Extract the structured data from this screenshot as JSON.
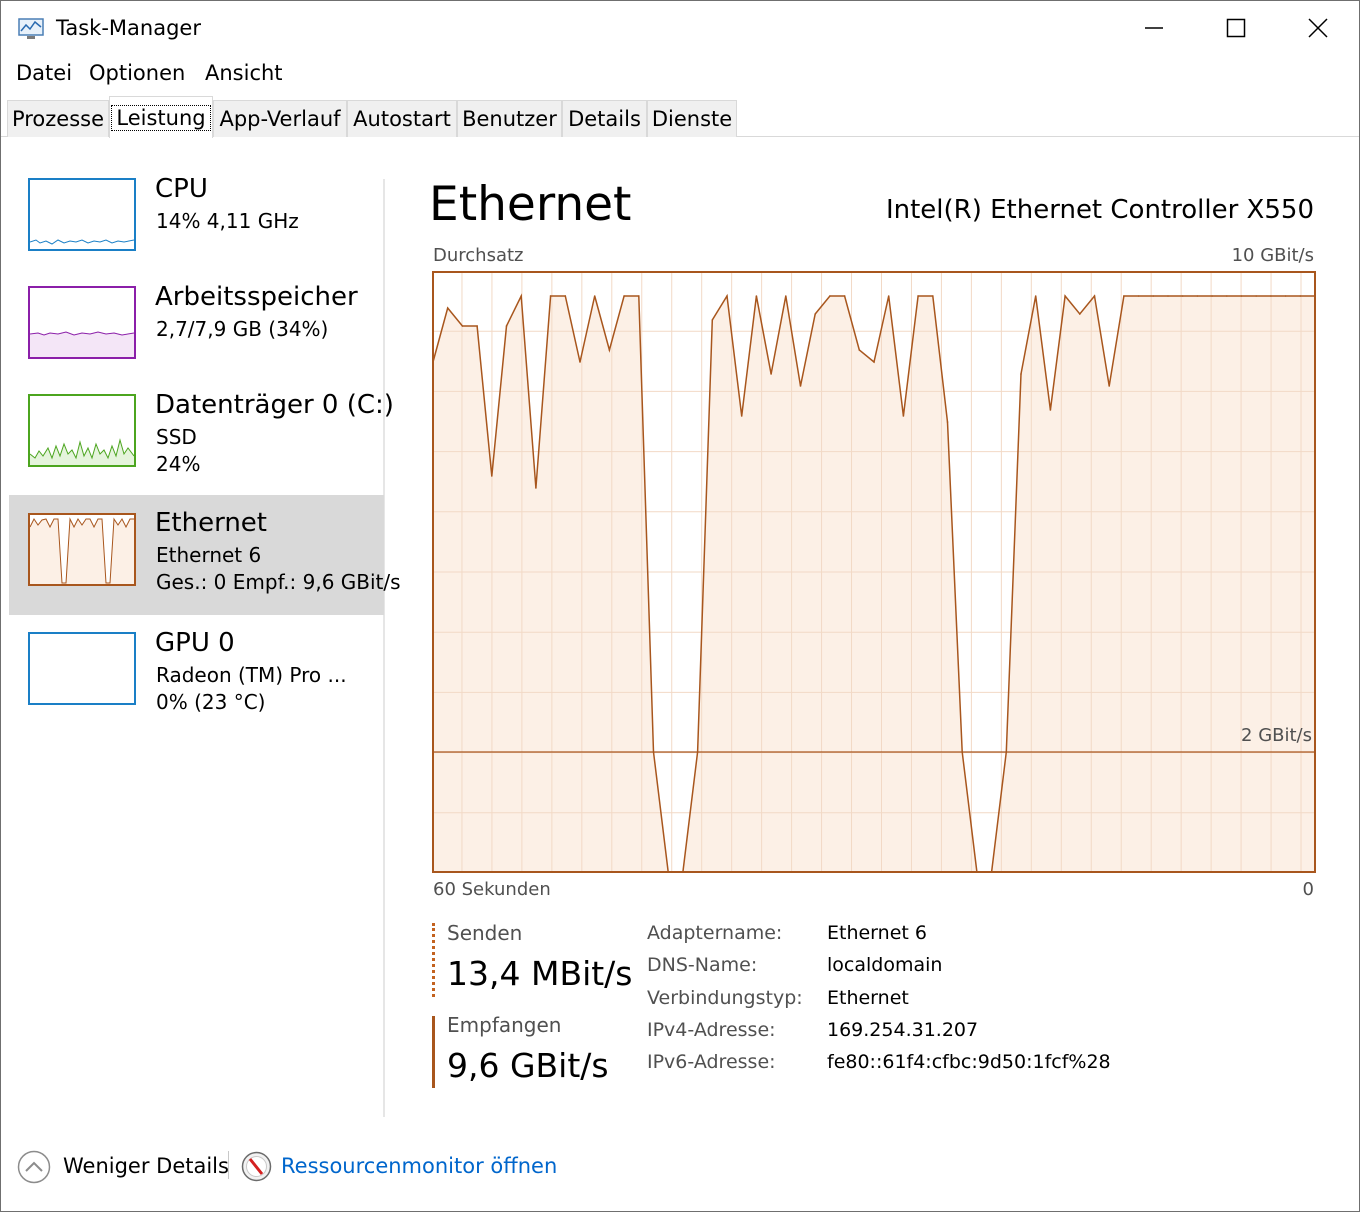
{
  "window": {
    "title": "Task-Manager"
  },
  "menu": [
    {
      "label": "Datei"
    },
    {
      "label": "Optionen"
    },
    {
      "label": "Ansicht"
    }
  ],
  "tabs": [
    {
      "label": "Prozesse"
    },
    {
      "label": "Leistung"
    },
    {
      "label": "App-Verlauf"
    },
    {
      "label": "Autostart"
    },
    {
      "label": "Benutzer"
    },
    {
      "label": "Details"
    },
    {
      "label": "Dienste"
    }
  ],
  "sidebar": {
    "items": [
      {
        "title": "CPU",
        "line1": "14% 4,11 GHz",
        "line2": "",
        "color": "#1a7fc6"
      },
      {
        "title": "Arbeitsspeicher",
        "line1": "2,7/7,9 GB (34%)",
        "line2": "",
        "color": "#8b1fa9"
      },
      {
        "title": "Datenträger 0 (C:)",
        "line1": "SSD",
        "line2": "24%",
        "color": "#4ca51f"
      },
      {
        "title": "Ethernet",
        "line1": "Ethernet 6",
        "line2": "Ges.: 0 Empf.: 9,6 GBit/s",
        "color": "#a8561d"
      },
      {
        "title": "GPU 0",
        "line1": "Radeon (TM) Pro ...",
        "line2": "0% (23 °C)",
        "color": "#1a7fc6"
      }
    ],
    "selected": "Ethernet"
  },
  "main": {
    "title": "Ethernet",
    "adapter": "Intel(R) Ethernet Controller X550",
    "graph_label": "Durchsatz",
    "graph_max": "10 GBit/s",
    "graph_mid": "2 GBit/s",
    "time_left": "60 Sekunden",
    "time_right": "0"
  },
  "stats": {
    "send_label": "Senden",
    "send_value": "13,4 MBit/s",
    "recv_label": "Empfangen",
    "recv_value": "9,6 GBit/s"
  },
  "properties": [
    {
      "label": "Adaptername:",
      "value": "Ethernet 6"
    },
    {
      "label": "DNS-Name:",
      "value": "localdomain"
    },
    {
      "label": "Verbindungstyp:",
      "value": "Ethernet"
    },
    {
      "label": "IPv4-Adresse:",
      "value": "169.254.31.207"
    },
    {
      "label": "IPv6-Adresse:",
      "value": "fe80::61f4:cfbc:9d50:1fcf%28"
    }
  ],
  "footer": {
    "fewer_details": "Weniger Details",
    "resource_monitor": "Ressourcenmonitor öffnen"
  },
  "colors": {
    "ethernet_line": "#a8561d",
    "ethernet_fill": "#fcf0e6",
    "ethernet_grid": "#f2d9c6",
    "link": "#0066cc"
  },
  "chart_data": {
    "type": "area",
    "title": "Durchsatz",
    "xlabel": "60 Sekunden",
    "x": [
      0,
      1,
      2,
      3,
      4,
      5,
      6,
      7,
      8,
      9,
      10,
      11,
      12,
      13,
      14,
      15,
      16,
      17,
      18,
      19,
      20,
      21,
      22,
      23,
      24,
      25,
      26,
      27,
      28,
      29,
      30,
      31,
      32,
      33,
      34,
      35,
      36,
      37,
      38,
      39,
      40,
      41,
      42,
      43,
      44,
      45,
      46,
      47,
      48,
      49,
      50,
      51,
      52,
      53,
      54,
      55,
      56,
      57,
      58,
      59,
      60
    ],
    "series": [
      {
        "values": [
          8.5,
          9.4,
          9.1,
          9.1,
          6.6,
          9.1,
          9.6,
          6.4,
          9.6,
          9.6,
          8.5,
          9.6,
          8.7,
          9.6,
          9.6,
          2.0,
          0,
          0,
          2.0,
          9.2,
          9.6,
          7.6,
          9.6,
          8.3,
          9.6,
          8.1,
          9.3,
          9.6,
          9.6,
          8.7,
          8.5,
          9.6,
          7.6,
          9.6,
          9.6,
          7.5,
          2.0,
          0,
          0,
          2.0,
          8.3,
          9.6,
          7.7,
          9.6,
          9.3,
          9.6,
          8.1,
          9.6,
          9.6,
          9.6,
          9.6,
          9.6,
          9.6,
          9.6,
          9.6,
          9.6,
          9.6,
          9.6,
          9.6,
          9.6,
          9.6
        ]
      }
    ],
    "ylim": [
      0,
      10
    ],
    "y_marker": 2,
    "grid": true
  }
}
